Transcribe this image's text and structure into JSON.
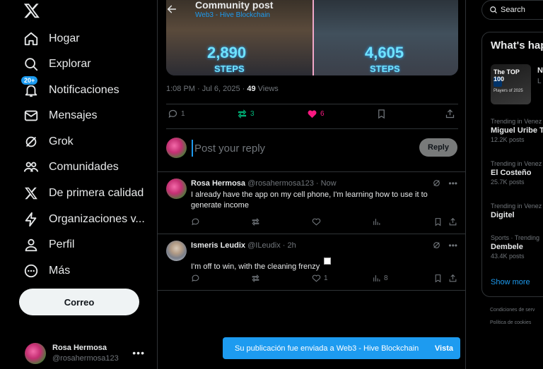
{
  "nav": {
    "items": [
      {
        "label": "Hogar",
        "icon": "home-icon"
      },
      {
        "label": "Explorar",
        "icon": "search-icon"
      },
      {
        "label": "Notificaciones",
        "icon": "bell-icon",
        "badge": "20+"
      },
      {
        "label": "Mensajes",
        "icon": "mail-icon"
      },
      {
        "label": "Grok",
        "icon": "grok-icon"
      },
      {
        "label": "Comunidades",
        "icon": "communities-icon"
      },
      {
        "label": "De primera calidad",
        "icon": "x-premium-icon"
      },
      {
        "label": "Organizaciones v...",
        "icon": "lightning-icon"
      },
      {
        "label": "Perfil",
        "icon": "person-icon"
      },
      {
        "label": "Más",
        "icon": "more-circle-icon"
      }
    ],
    "post_button": "Correo"
  },
  "account": {
    "name": "Rosa Hermosa",
    "handle": "@rosahermosa123"
  },
  "header": {
    "title": "Community post",
    "subtitle": "Web3 - Hive Blockchain"
  },
  "media": {
    "left_value": "2,890",
    "left_label": "STEPS",
    "right_value": "4,605",
    "right_label": "STEPS"
  },
  "post": {
    "time": "1:08 PM · Jul 6, 2025 ·",
    "views_count": "49",
    "views_label": "Views",
    "replies": "1",
    "reposts": "3",
    "likes": "6"
  },
  "reply_box": {
    "placeholder": "Post your reply",
    "button": "Reply"
  },
  "replies": [
    {
      "name": "Rosa Hermosa",
      "handle": "@rosahermosa123 · Now",
      "text": "I already have the app on my cell phone, I'm learning how to use it to generate income",
      "likes": "",
      "views": ""
    },
    {
      "name": "Ismeris Leudix",
      "handle": "@ILeudix · 2h",
      "text": "I'm off to win, with the cleaning frenzy",
      "likes": "1",
      "views": "8"
    }
  ],
  "toast": {
    "text": "Su publicación fue enviada a Web3 - Hive Blockchain",
    "link": "Vista"
  },
  "search": {
    "placeholder": "Search"
  },
  "trends": {
    "title": "What's hap",
    "promo_top": "The TOP 100",
    "promo_sub": "Players of 2025",
    "promo_name": "N",
    "promo_line": "L",
    "items": [
      {
        "context": "Trending in Venez",
        "name": "Miguel Uribe T",
        "count": "12.2K posts"
      },
      {
        "context": "Trending in Venez",
        "name": "El Costeño",
        "count": "25.7K posts"
      },
      {
        "context": "Trending in Venez",
        "name": "Digitel",
        "count": ""
      },
      {
        "context": "Sports · Trending",
        "name": "Dembele",
        "count": "43.4K posts"
      }
    ],
    "show_more": "Show more"
  },
  "footer": {
    "terms": "Condiciones de serv",
    "cookies": "Política de cookies"
  },
  "colors": {
    "accent": "#1d9bf0",
    "repost_active": "#00ba7c",
    "like_active": "#f91880",
    "muted": "#71767b"
  }
}
